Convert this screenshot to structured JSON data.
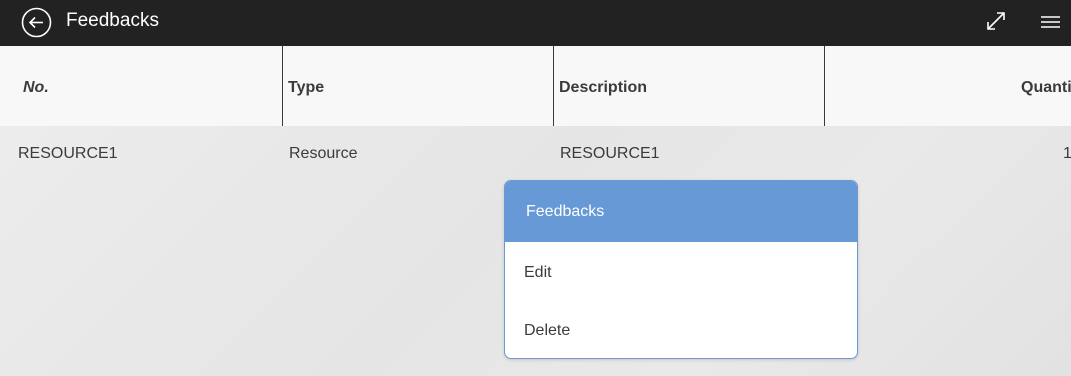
{
  "header": {
    "title": "Feedbacks",
    "back_icon": "back-arrow-circle-icon",
    "expand_icon": "expand-diagonal-icon",
    "menu_icon": "hamburger-menu-icon"
  },
  "table": {
    "columns": [
      "No.",
      "Type",
      "Description",
      "Quanti"
    ],
    "rows": [
      [
        "RESOURCE1",
        "Resource",
        "RESOURCE1",
        "1."
      ]
    ]
  },
  "popup": {
    "title": "Feedbacks",
    "items": [
      "Edit",
      "Delete"
    ],
    "accent_color": "#6699d5"
  },
  "colors": {
    "topbar": "#222222",
    "header_bg": "#f8f8f8",
    "text": "#3b3b3b"
  }
}
